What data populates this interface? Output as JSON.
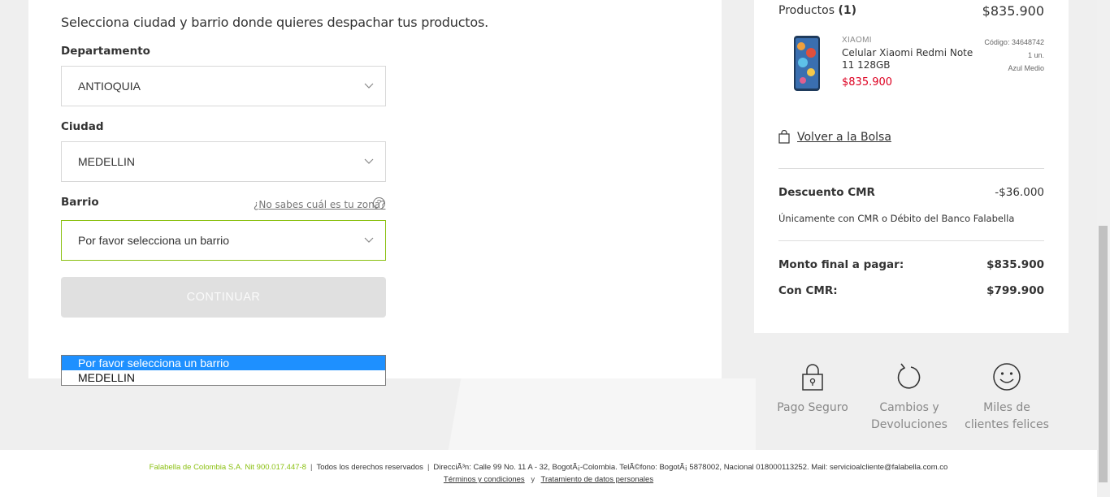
{
  "form": {
    "intro": "Selecciona ciudad y barrio donde quieres despachar tus productos.",
    "departamento_label": "Departamento",
    "departamento_value": "ANTIOQUIA",
    "ciudad_label": "Ciudad",
    "ciudad_value": "MEDELLIN",
    "barrio_label": "Barrio",
    "barrio_help": "¿No sabes cuál es tu zona?",
    "barrio_value": "Por favor selecciona un barrio",
    "continue_label": "CONTINUAR"
  },
  "dropdown": {
    "options": [
      "Por favor selecciona un barrio",
      "MEDELLIN"
    ]
  },
  "summary": {
    "products_label": "Productos",
    "products_count": "(1)",
    "products_total": "$835.900",
    "item": {
      "brand": "XIAOMI",
      "name": "Celular Xiaomi Redmi Note 11 128GB",
      "price": "$835.900",
      "code": "Código: 34648742",
      "qty": "1 un.",
      "color": "Azul Medio"
    },
    "back_to_bag": "Volver a la Bolsa",
    "discount_label": "Descuento CMR",
    "discount_value": "-$36.000",
    "discount_note": "Únicamente con CMR o Débito del Banco Falabella",
    "final_label": "Monto final a pagar:",
    "final_value": "$835.900",
    "cmr_label": "Con CMR:",
    "cmr_value": "$799.900"
  },
  "badges": [
    {
      "icon": "lock-icon",
      "label": "Pago Seguro"
    },
    {
      "icon": "refresh-icon",
      "label": "Cambios y Devoluciones"
    },
    {
      "icon": "smiley-icon",
      "label": "Miles de clientes felices"
    }
  ],
  "footer": {
    "company": "Falabella de Colombia S.A. Nit 900.017.447-8",
    "rights": "Todos los derechos reservados",
    "address": "DirecciÃ³n: Calle 99 No. 11 A - 32, BogotÃ¡-Colombia. TelÃ©fono: BogotÃ¡ 5878002, Nacional 018000113252. Mail: servicioalcliente@falabella.com.co",
    "terms": "Términos y condiciones",
    "and": "y",
    "privacy": "Tratamiento de datos personales"
  },
  "colors": {
    "accent_green": "#8ac010",
    "price_red": "#dd0021",
    "dropdown_highlight": "#1e90ff"
  }
}
